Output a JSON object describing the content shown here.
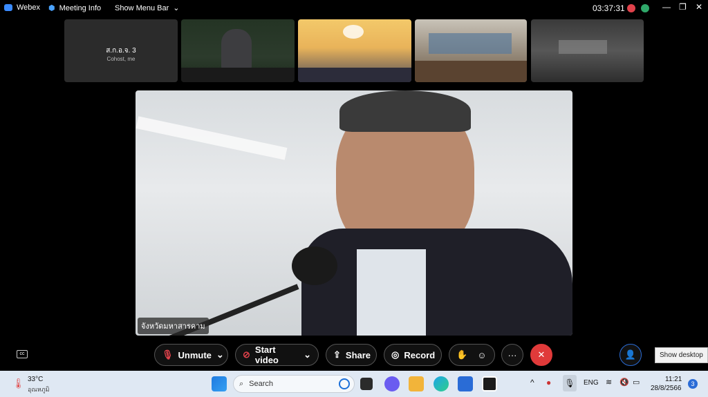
{
  "topbar": {
    "app_name": "Webex",
    "meeting_info": "Meeting Info",
    "show_menu_bar": "Show Menu Bar",
    "timer": "03:37:31"
  },
  "thumbnails": [
    {
      "name": "ส.ก.อ.จ. 3",
      "sub": "Cohost, me"
    }
  ],
  "main_video": {
    "name_tag": "จังหวัดมหาสารคาม"
  },
  "controls": {
    "unmute": "Unmute",
    "start_video": "Start video",
    "share": "Share",
    "record": "Record",
    "more": "···",
    "end": "✕"
  },
  "tooltip": "Show desktop",
  "taskbar": {
    "weather_temp": "33°C",
    "weather_label": "อุณหภูมิ",
    "search_placeholder": "Search",
    "lang": "ENG",
    "time": "11:21",
    "date": "28/8/2566",
    "notif_count": "3"
  },
  "colors": {
    "end_button": "#e03a3a",
    "accent": "#2a6cd6"
  }
}
